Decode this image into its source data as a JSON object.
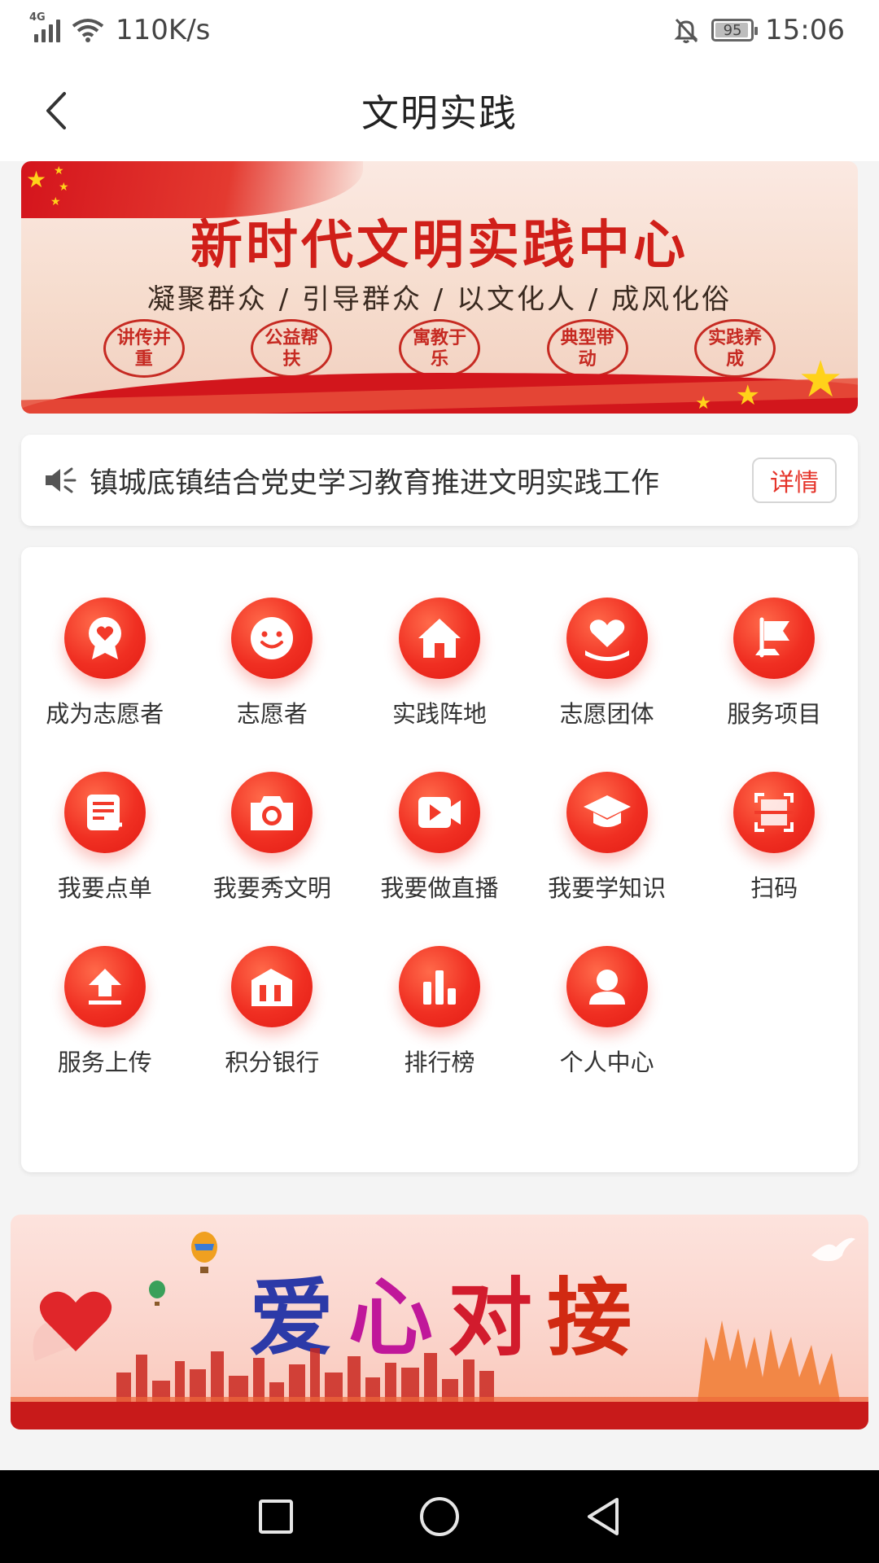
{
  "status_bar": {
    "network_type": "4G",
    "speed": "110K/s",
    "battery": "95",
    "time": "15:06"
  },
  "header": {
    "title": "文明实践"
  },
  "banner_top": {
    "title": "新时代文明实践中心",
    "subtitle": "凝聚群众 / 引导群众 / 以文化人 / 成风化俗",
    "seals": [
      "讲传并重",
      "公益帮扶",
      "寓教于乐",
      "典型带动",
      "实践养成"
    ]
  },
  "notice": {
    "text": "镇城底镇结合党史学习教育推进文明实践工作",
    "button_label": "详情"
  },
  "grid": {
    "items": [
      {
        "label": "成为志愿者",
        "icon": "badge-heart-icon"
      },
      {
        "label": "志愿者",
        "icon": "smile-icon"
      },
      {
        "label": "实践阵地",
        "icon": "home-icon"
      },
      {
        "label": "志愿团体",
        "icon": "hand-heart-icon"
      },
      {
        "label": "服务项目",
        "icon": "flag-icon"
      },
      {
        "label": "我要点单",
        "icon": "order-icon"
      },
      {
        "label": "我要秀文明",
        "icon": "camera-icon"
      },
      {
        "label": "我要做直播",
        "icon": "video-icon"
      },
      {
        "label": "我要学知识",
        "icon": "graduation-cap-icon"
      },
      {
        "label": "扫码",
        "icon": "scan-icon"
      },
      {
        "label": "服务上传",
        "icon": "upload-icon"
      },
      {
        "label": "积分银行",
        "icon": "bank-icon"
      },
      {
        "label": "排行榜",
        "icon": "bar-chart-icon"
      },
      {
        "label": "个人中心",
        "icon": "user-icon"
      }
    ]
  },
  "banner_bottom": {
    "title_chars": [
      "爱",
      "心",
      "对",
      "接"
    ]
  },
  "colors": {
    "accent": "#f02f22",
    "accent_dark": "#d01f19",
    "page_bg": "#f4f4f4"
  }
}
